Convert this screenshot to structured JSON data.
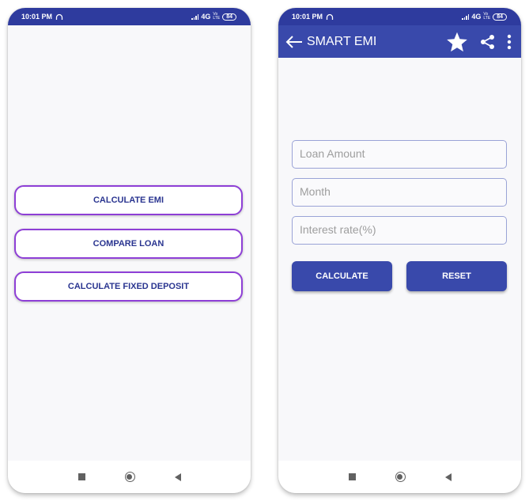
{
  "status_bar": {
    "time": "10:01 PM",
    "network": "4G",
    "volte_top": "Vo",
    "volte_bottom": "LTE",
    "battery": "84"
  },
  "left_screen": {
    "buttons": [
      {
        "label": "CALCULATE EMI"
      },
      {
        "label": "COMPARE LOAN"
      },
      {
        "label": "CALCULATE FIXED DEPOSIT"
      }
    ]
  },
  "right_screen": {
    "app_bar": {
      "back_icon": "arrow-left-icon",
      "title": "SMART EMI",
      "actions": [
        "star-icon",
        "share-icon",
        "more-vert-icon"
      ]
    },
    "fields": [
      {
        "placeholder": "Loan Amount",
        "value": ""
      },
      {
        "placeholder": "Month",
        "value": ""
      },
      {
        "placeholder": "Interest rate(%)",
        "value": ""
      }
    ],
    "calculate_label": "CALCULATE",
    "reset_label": "RESET"
  },
  "nav_bar": {
    "icons": [
      "recents-square-icon",
      "home-circle-icon",
      "back-triangle-icon"
    ]
  },
  "colors": {
    "status_bar": "#2e3b9e",
    "primary": "#3949ab",
    "menu_border": "#8e3fd6",
    "menu_text": "#2a3590"
  }
}
